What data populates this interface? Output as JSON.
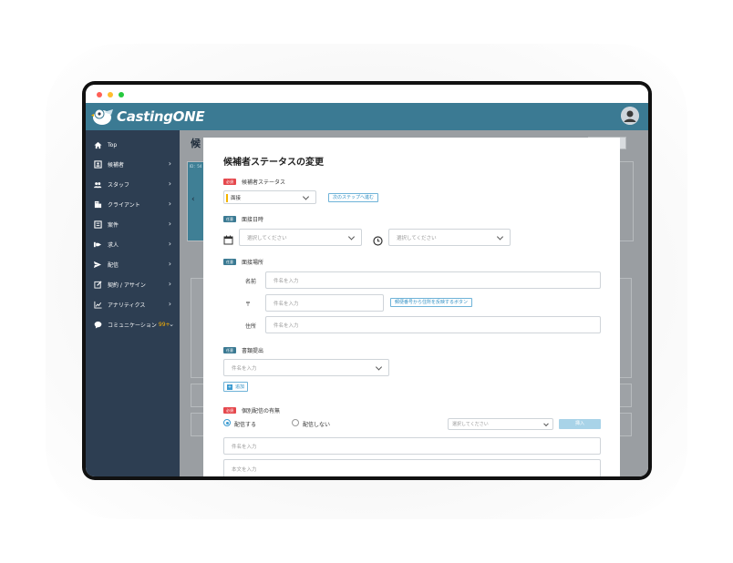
{
  "app": {
    "logo_text": "CastingONE"
  },
  "sidebar": {
    "items": [
      {
        "label": "Top",
        "icon": "home-icon"
      },
      {
        "label": "候補者",
        "icon": "candidate-icon"
      },
      {
        "label": "スタッフ",
        "icon": "staff-icon"
      },
      {
        "label": "クライアント",
        "icon": "client-icon"
      },
      {
        "label": "案件",
        "icon": "project-icon"
      },
      {
        "label": "求人",
        "icon": "job-icon"
      },
      {
        "label": "配信",
        "icon": "send-icon"
      },
      {
        "label": "契約 / アサイン",
        "icon": "contract-icon"
      },
      {
        "label": "アナリティクス",
        "icon": "analytics-icon"
      },
      {
        "label": "コミュニケーション",
        "icon": "chat-icon",
        "badge": "99+"
      }
    ]
  },
  "background": {
    "page_title_fragment": "候",
    "id_fragment": "ID：54"
  },
  "modal": {
    "title": "候補者ステータスの変更",
    "status": {
      "required_tag": "必須",
      "label": "候補者ステータス",
      "value": "面接",
      "next_step_button": "次のステップへ進む"
    },
    "datetime": {
      "tag": "任意",
      "label": "面接日時",
      "date_placeholder": "選択してください",
      "time_placeholder": "選択してください"
    },
    "place": {
      "tag": "任意",
      "label": "面接場所",
      "name_label": "名前",
      "name_placeholder": "件名を入力",
      "zip_label": "〒",
      "zip_placeholder": "件名を入力",
      "zip_button": "郵便番号から住所を反映するボタン",
      "address_label": "住所",
      "address_placeholder": "件名を入力"
    },
    "document": {
      "tag": "任意",
      "label": "書類提出",
      "placeholder": "件名を入力",
      "add_button": "追加"
    },
    "delivery": {
      "required_tag": "必須",
      "label": "個別配信の有無",
      "option_yes": "配信する",
      "option_no": "配信しない",
      "template_placeholder": "選択してください",
      "insert_button": "挿入",
      "subject_placeholder": "件名を入力",
      "body_placeholder": "本文を入力"
    }
  },
  "colors": {
    "header": "#3b7a93",
    "sidebar": "#2d3e52",
    "required": "#e5484d",
    "optional": "#3b7a93",
    "link": "#2f8fc4"
  }
}
